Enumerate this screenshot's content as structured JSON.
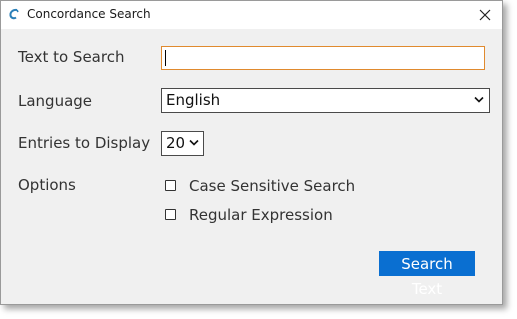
{
  "window": {
    "title": "Concordance Search"
  },
  "form": {
    "text_to_search_label": "Text to Search",
    "text_to_search_value": "",
    "language_label": "Language",
    "language_selected": "English",
    "entries_label": "Entries to Display",
    "entries_selected": "20",
    "options_label": "Options",
    "case_sensitive_label": "Case Sensitive Search",
    "case_sensitive_checked": false,
    "regex_label": "Regular Expression",
    "regex_checked": false
  },
  "actions": {
    "search_label": "Search Text"
  },
  "colors": {
    "accent": "#0a6fd1",
    "focus_border": "#e08a2e"
  },
  "icons": {
    "app": "app-icon",
    "close": "close-icon",
    "dropdown": "chevron-down-icon"
  }
}
